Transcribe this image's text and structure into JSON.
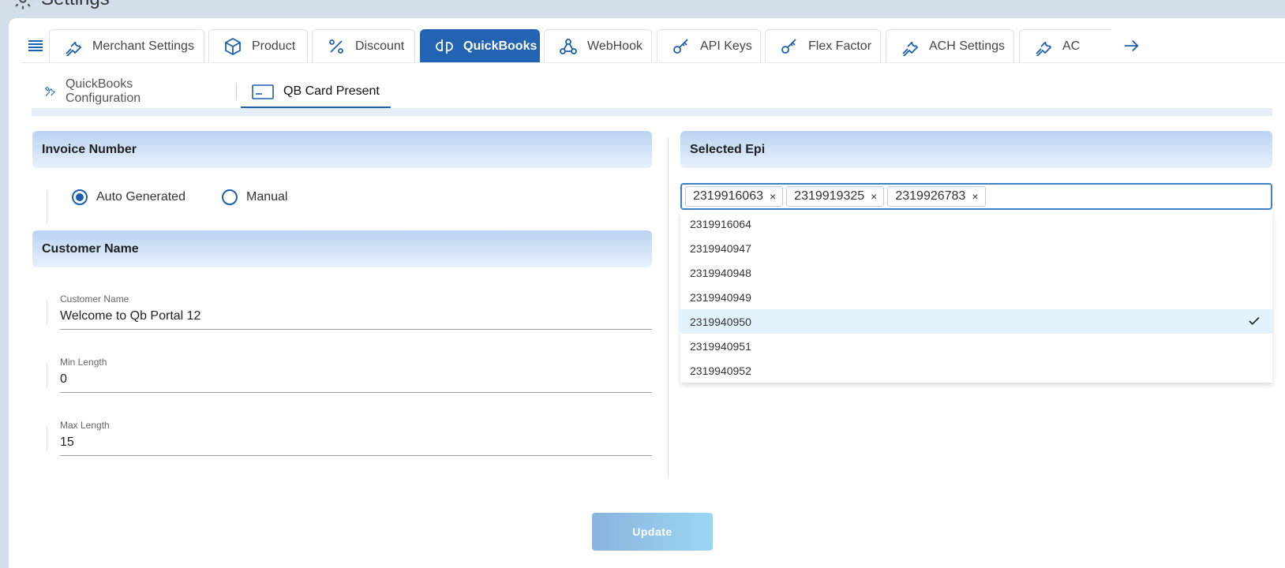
{
  "page": {
    "title": "Settings"
  },
  "tabs": [
    {
      "label": "Merchant Settings",
      "icon": "wrench-icon"
    },
    {
      "label": "Product",
      "icon": "box-icon"
    },
    {
      "label": "Discount",
      "icon": "percent-icon"
    },
    {
      "label": "QuickBooks",
      "icon": "quickbooks-icon",
      "active": true
    },
    {
      "label": "WebHook",
      "icon": "webhook-icon"
    },
    {
      "label": "API Keys",
      "icon": "key-icon"
    },
    {
      "label": "Flex Factor",
      "icon": "key-icon"
    },
    {
      "label": "ACH Settings",
      "icon": "wrench-icon"
    },
    {
      "label": "AC",
      "icon": "wrench-icon"
    }
  ],
  "subtabs": [
    {
      "label": "QuickBooks Configuration",
      "icon": "tools-icon"
    },
    {
      "label": "QB Card Present",
      "icon": "card-icon",
      "active": true
    }
  ],
  "invoice": {
    "heading": "Invoice Number",
    "options": [
      {
        "label": "Auto Generated",
        "checked": true
      },
      {
        "label": "Manual",
        "checked": false
      }
    ]
  },
  "customer": {
    "heading": "Customer Name",
    "fields": [
      {
        "label": "Customer Name",
        "value": "Welcome to Qb Portal  12"
      },
      {
        "label": "Min Length",
        "value": "0"
      },
      {
        "label": "Max Length",
        "value": "15"
      }
    ]
  },
  "epi": {
    "heading": "Selected Epi",
    "selected": [
      "2319916063",
      "2319919325",
      "2319926783"
    ],
    "remove_glyph": "×",
    "options": [
      "2319916064",
      "2319940947",
      "2319940948",
      "2319940949",
      "2319940950",
      "2319940951",
      "2319940952"
    ],
    "highlighted": "2319940950"
  },
  "update_label": "Update",
  "colors": {
    "primary": "#2363b3",
    "accent": "#1c5fb0",
    "header_gradient_top": "#b9d3f2",
    "highlight": "#e3f3fd"
  }
}
